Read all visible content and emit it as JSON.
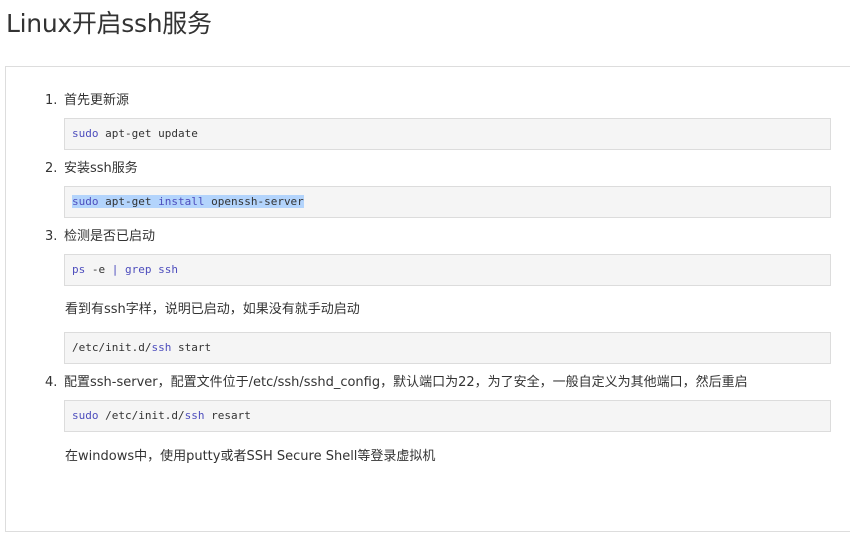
{
  "page": {
    "title": "Linux开启ssh服务"
  },
  "steps": [
    {
      "number": "1.",
      "label": "首先更新源",
      "code": [
        {
          "t": "sudo",
          "kw": true
        },
        {
          "t": " apt-get update",
          "kw": false
        }
      ]
    },
    {
      "number": "2.",
      "label": "安装ssh服务",
      "code": [
        {
          "t": "sudo",
          "kw": true
        },
        {
          "t": " apt-get ",
          "kw": false
        },
        {
          "t": "install",
          "kw": true
        },
        {
          "t": " openssh-server",
          "kw": false
        }
      ],
      "selected": true
    },
    {
      "number": "3.",
      "label": "检测是否已启动",
      "code": [
        {
          "t": "ps",
          "kw": true
        },
        {
          "t": " -e ",
          "kw": false
        },
        {
          "t": "|",
          "kw": true
        },
        {
          "t": " ",
          "kw": false
        },
        {
          "t": "grep",
          "kw": true
        },
        {
          "t": " ",
          "kw": false
        },
        {
          "t": "ssh",
          "kw": true
        }
      ],
      "note": "看到有ssh字样，说明已启动，如果没有就手动启动",
      "code2": [
        {
          "t": "/etc/init.d/",
          "kw": false
        },
        {
          "t": "ssh",
          "kw": true
        },
        {
          "t": " start",
          "kw": false
        }
      ]
    },
    {
      "number": "4.",
      "label": "配置ssh-server，配置文件位于/etc/ssh/sshd_config，默认端口为22，为了安全，一般自定义为其他端口，然后重启",
      "code": [
        {
          "t": "sudo",
          "kw": true
        },
        {
          "t": " /etc/init.d/",
          "kw": false
        },
        {
          "t": "ssh",
          "kw": true
        },
        {
          "t": " resart",
          "kw": false
        }
      ]
    }
  ],
  "footer_note": "在windows中，使用putty或者SSH Secure Shell等登录虚拟机",
  "colors": {
    "keyword": "#4d4dbd",
    "code_background": "#f5f5f5",
    "selection": "#b3d4fc"
  }
}
